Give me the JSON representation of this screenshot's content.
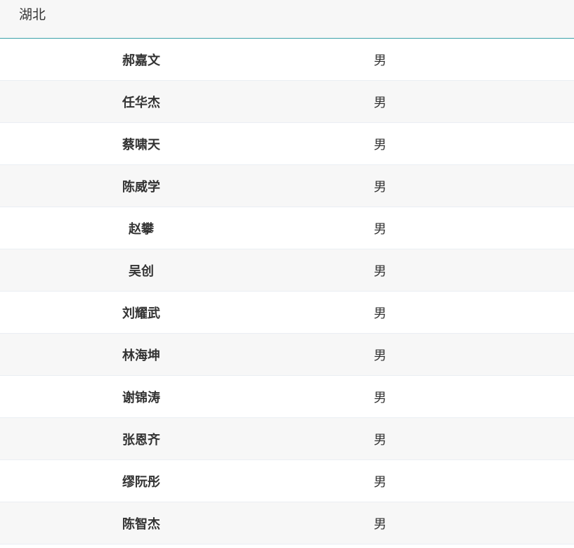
{
  "panel": {
    "title": "湖北"
  },
  "rows": [
    {
      "name": "郝嘉文",
      "gender": "男"
    },
    {
      "name": "任华杰",
      "gender": "男"
    },
    {
      "name": "蔡啸天",
      "gender": "男"
    },
    {
      "name": "陈威学",
      "gender": "男"
    },
    {
      "name": "赵攀",
      "gender": "男"
    },
    {
      "name": "吴创",
      "gender": "男"
    },
    {
      "name": "刘耀武",
      "gender": "男"
    },
    {
      "name": "林海坤",
      "gender": "男"
    },
    {
      "name": "谢锦涛",
      "gender": "男"
    },
    {
      "name": "张恩齐",
      "gender": "男"
    },
    {
      "name": "缪阮彤",
      "gender": "男"
    },
    {
      "name": "陈智杰",
      "gender": "男"
    }
  ]
}
